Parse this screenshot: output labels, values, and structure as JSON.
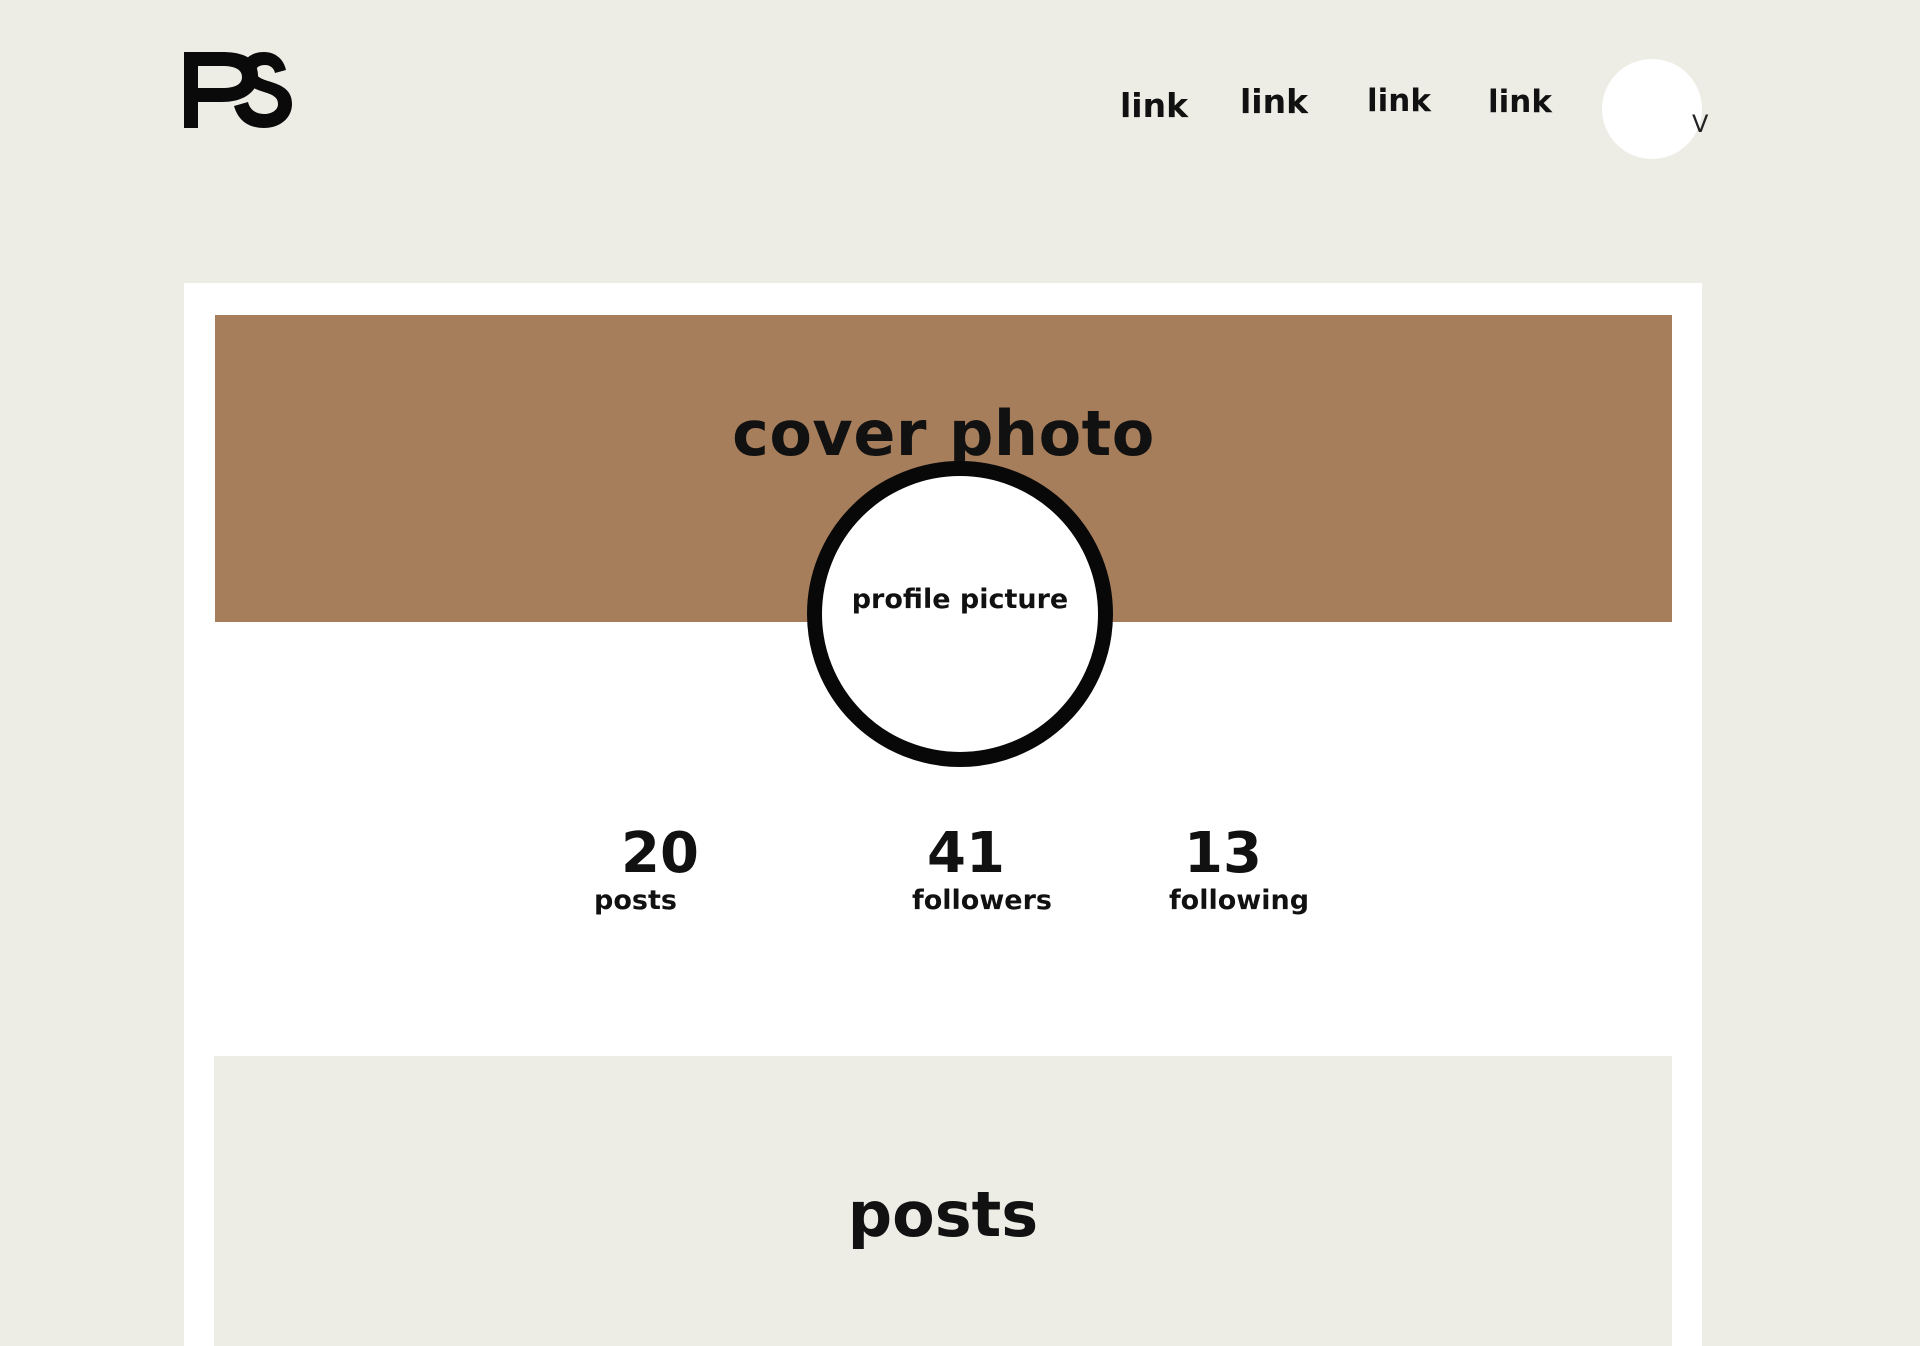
{
  "header": {
    "logo_text": "PS",
    "nav_links": [
      "link",
      "link",
      "link",
      "link"
    ],
    "avatar_caret": "V"
  },
  "profile": {
    "cover_label": "cover photo",
    "picture_label": "profile picture",
    "stats": [
      {
        "value": "20",
        "label": "posts"
      },
      {
        "value": "41",
        "label": "followers"
      },
      {
        "value": "13",
        "label": "following"
      }
    ]
  },
  "posts": {
    "title": "posts"
  },
  "colors": {
    "background": "#edede6",
    "card": "#ffffff",
    "cover": "#a77e5c",
    "text": "#111111"
  }
}
